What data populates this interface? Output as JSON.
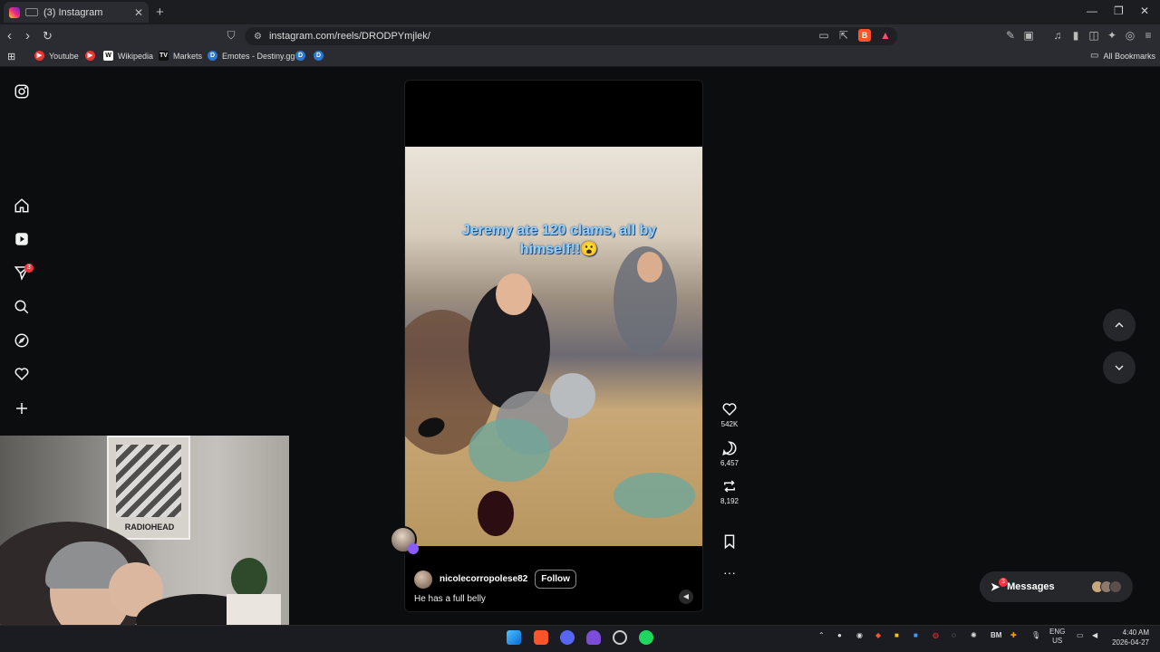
{
  "browser": {
    "tab_title": "(3) Instagram",
    "new_tab": "+",
    "url": "instagram.com/reels/DRODPYmjlek/",
    "bookmarks": [
      "Youtube",
      "Wikipedia",
      "Markets",
      "Emotes - Destiny.gg"
    ],
    "all_bookmarks": "All Bookmarks"
  },
  "sidebar": {
    "notification_count": "3"
  },
  "reel": {
    "overlay_text": "Jeremy ate 120 clams, all by himself!!😮",
    "username": "nicolecorropolese82",
    "follow_label": "Follow",
    "caption": "He has a full belly",
    "likes": "542K",
    "comments": "6,457",
    "reposts": "8,192"
  },
  "messages": {
    "label": "Messages",
    "badge": "3"
  },
  "webcam": {
    "poster_text": "RADIOHEAD"
  },
  "taskbar": {
    "lang_top": "ENG",
    "lang_bottom": "US",
    "time": "4:40 AM",
    "date": "2026-04-27",
    "tray_bm": "BM"
  }
}
